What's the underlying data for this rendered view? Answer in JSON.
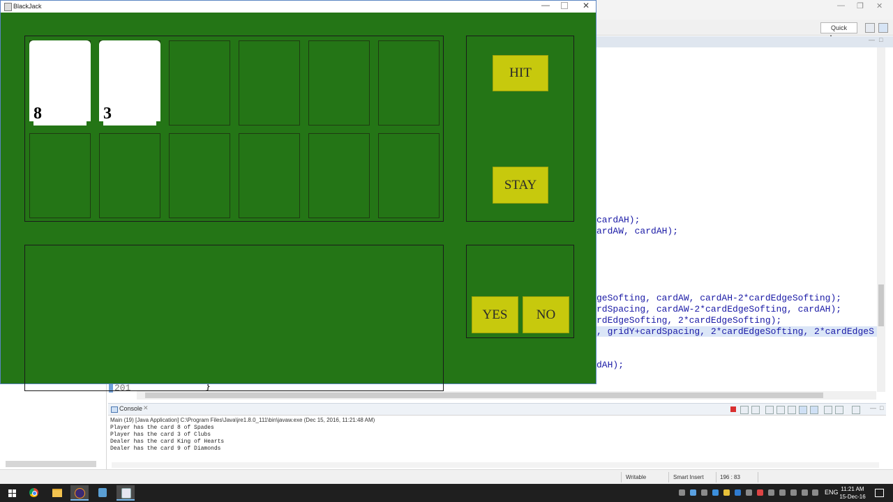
{
  "ide": {
    "quick_access": "Quick Access",
    "code_lines": [
      {
        "text": "cardAH);",
        "hl": false
      },
      {
        "text": "ardAW, cardAH);",
        "hl": false
      },
      {
        "text": "geSofting, cardAW, cardAH-2*cardEdgeSofting);",
        "hl": false
      },
      {
        "text": "rdSpacing, cardAW-2*cardEdgeSofting, cardAH);",
        "hl": false
      },
      {
        "text": "rdEdgeSofting, 2*cardEdgeSofting);",
        "hl": false
      },
      {
        "text": ", gridY+cardSpacing, 2*cardEdgeSofting, 2*cardEdgeS",
        "hl": true
      },
      {
        "text": "dAH);",
        "hl": false
      }
    ],
    "line_number": "201",
    "brace": "}"
  },
  "console": {
    "tab_label": "Console",
    "close": "✕",
    "header": "Main (19) [Java Application] C:\\Program Files\\Java\\jre1.8.0_111\\bin\\javaw.exe (Dec 15, 2016, 11:21:48 AM)",
    "lines": [
      "Player has the card 8 of Spades",
      "Player has the card 3 of Clubs",
      "Dealer has the card King of Hearts",
      "Dealer has the card 9 of Diamonds"
    ]
  },
  "status": {
    "writable": "Writable",
    "insert_mode": "Smart Insert",
    "position": "196 : 83"
  },
  "taskbar": {
    "language": "ENG",
    "time": "11:21 AM",
    "date": "15-Dec-16"
  },
  "blackjack": {
    "title": "BlackJack",
    "player_cards": [
      {
        "value": "8",
        "visible": true
      },
      {
        "value": "3",
        "visible": true
      }
    ],
    "buttons": {
      "hit": "HIT",
      "stay": "STAY",
      "yes": "YES",
      "no": "NO"
    },
    "colors": {
      "table": "#247516",
      "button": "#c7c90d"
    }
  }
}
